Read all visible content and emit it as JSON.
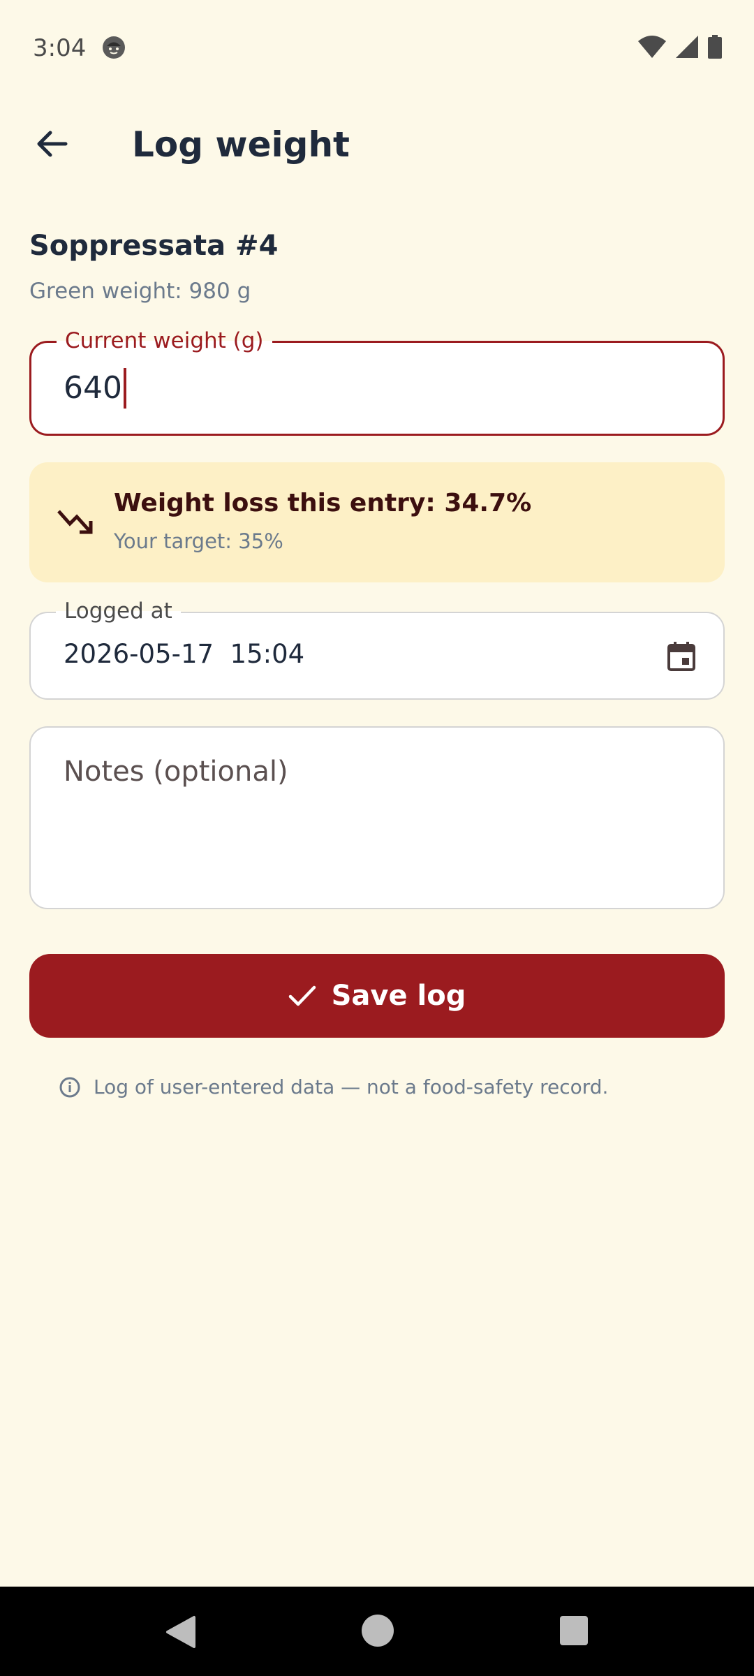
{
  "status_bar": {
    "time": "3:04",
    "icons": [
      "face-notification-icon",
      "wifi-icon",
      "cellular-signal-icon",
      "battery-icon"
    ]
  },
  "app_bar": {
    "back_icon": "arrow-back-icon",
    "title": "Log weight"
  },
  "item": {
    "name": "Soppressata #4",
    "green_weight": "Green weight: 980 g"
  },
  "weight_field": {
    "label": "Current weight (g)",
    "value": "640",
    "focused": true
  },
  "loss_card": {
    "icon": "trending-down-icon",
    "title": "Weight loss this entry: 34.7%",
    "target": "Your target: 35%"
  },
  "logged_field": {
    "label": "Logged at",
    "value": "2026-05-17  15:04",
    "icon": "calendar-icon"
  },
  "notes_field": {
    "placeholder": "Notes (optional)",
    "value": ""
  },
  "save_button": {
    "icon": "check-icon",
    "label": "Save log"
  },
  "disclaimer": {
    "icon": "info-icon",
    "text": "Log of user-entered data — not a food-safety record."
  },
  "colors": {
    "background": "#fdf9e8",
    "accent": "#9b1b1f",
    "card": "#fdf0c6",
    "text_primary": "#1f2a3c",
    "text_secondary": "#6b7a8c"
  },
  "nav_bar": {
    "icons": [
      "nav-back-icon",
      "nav-home-icon",
      "nav-recents-icon"
    ]
  }
}
